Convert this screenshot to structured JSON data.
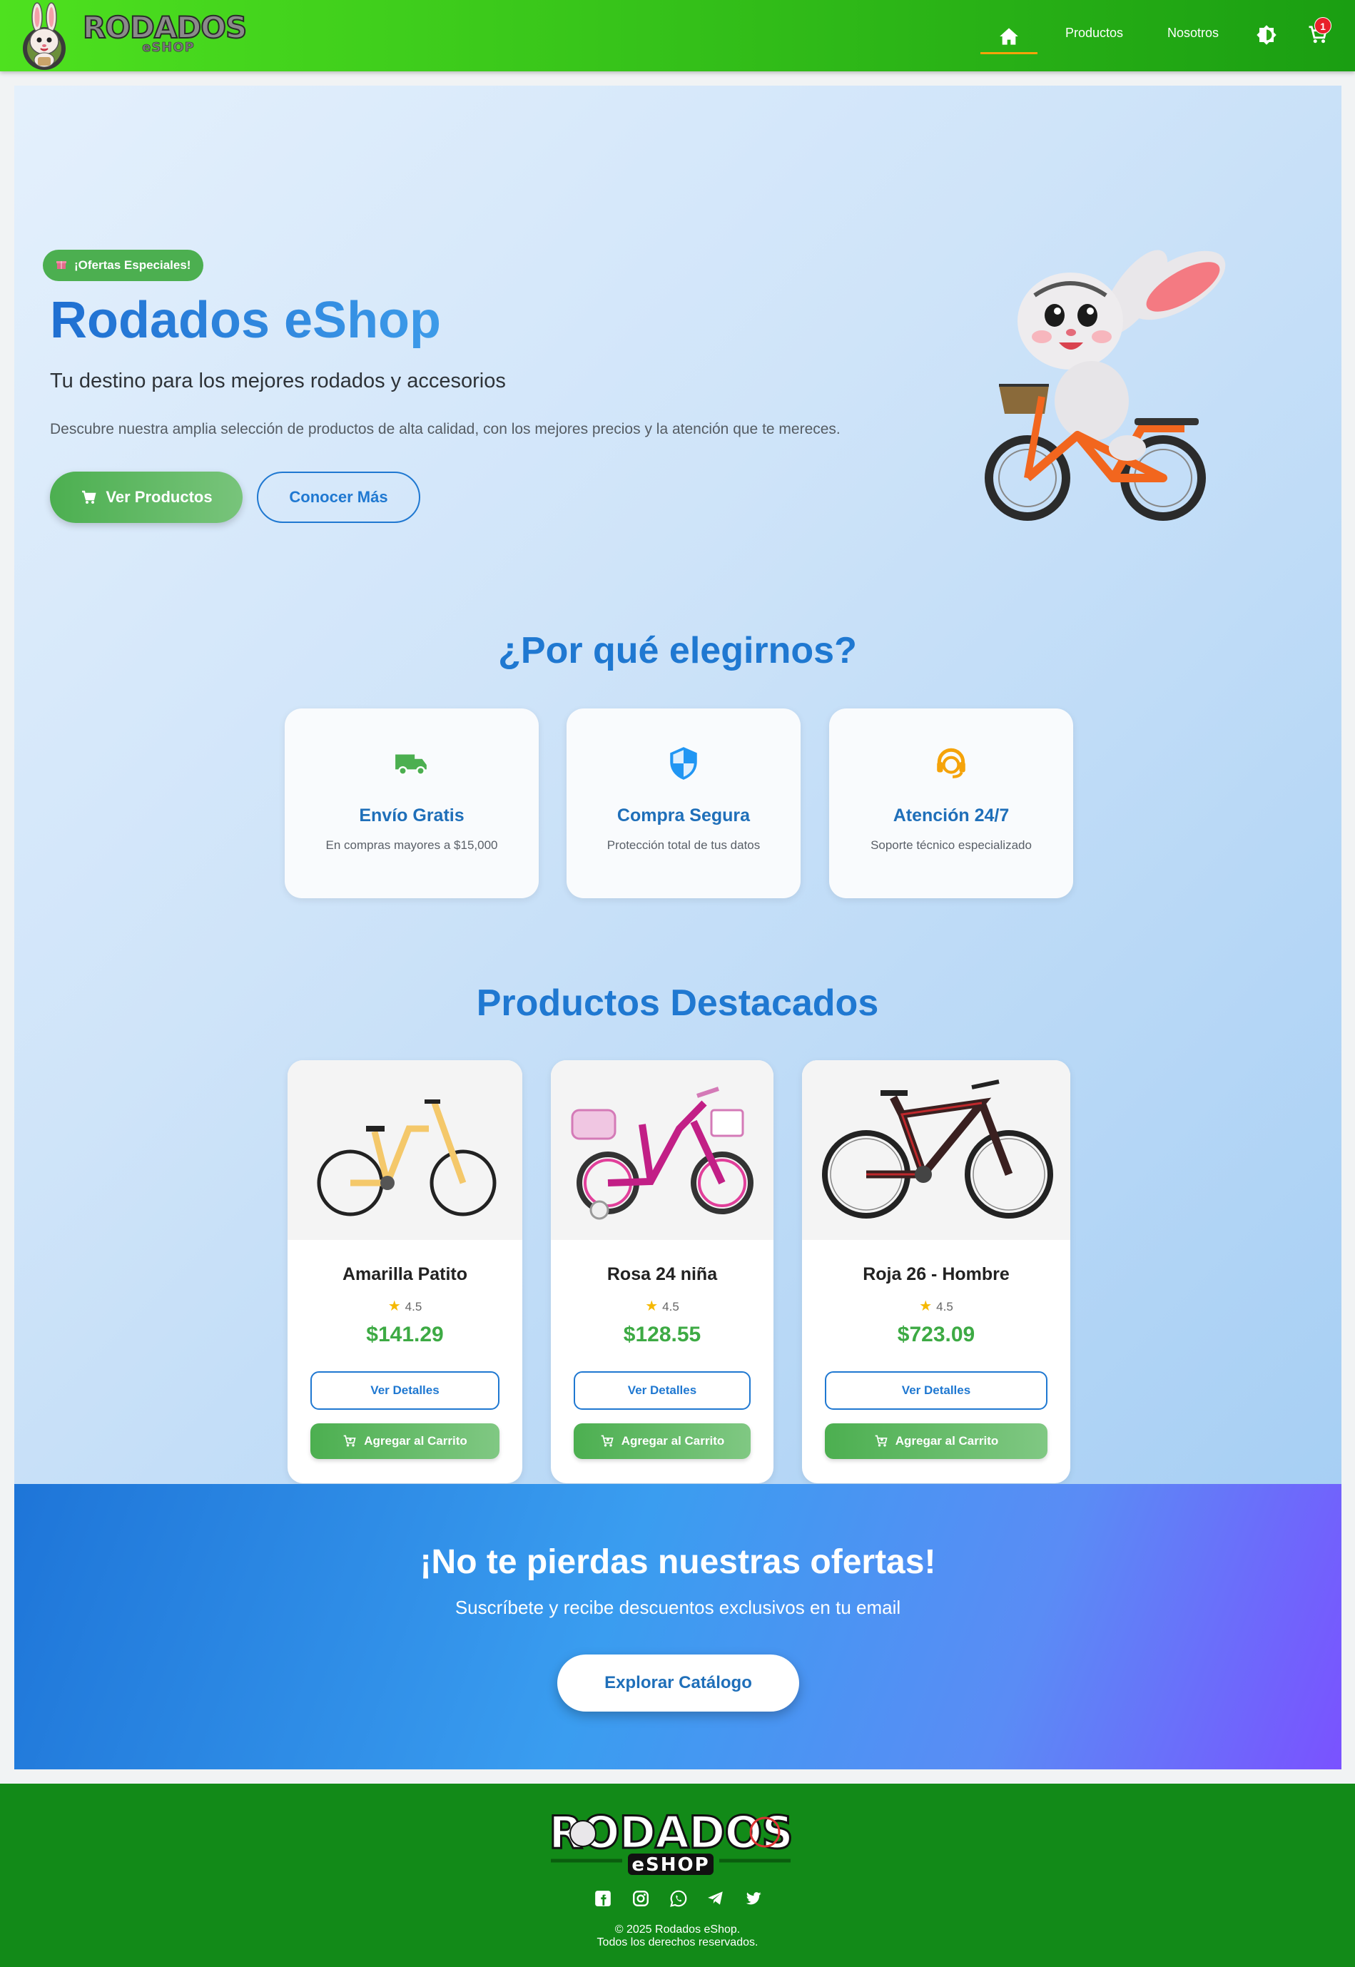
{
  "brand": {
    "logo_main": "RODADOS",
    "logo_sub": "eSHOP"
  },
  "nav": {
    "products": "Productos",
    "about": "Nosotros",
    "cart_count": "1"
  },
  "hero": {
    "badge": "¡Ofertas Especiales!",
    "title": "Rodados eShop",
    "subtitle": "Tu destino para los mejores rodados y accesorios",
    "description": "Descubre nuestra amplia selección de productos de alta calidad, con los mejores precios y la atención que te mereces.",
    "btn_products": "Ver Productos",
    "btn_more": "Conocer Más"
  },
  "why": {
    "title": "¿Por qué elegirnos?",
    "features": [
      {
        "name": "Envío Gratis",
        "desc": "En compras mayores a $15,000",
        "icon": "truck-icon",
        "color": "#4caf50"
      },
      {
        "name": "Compra Segura",
        "desc": "Protección total de tus datos",
        "icon": "shield-icon",
        "color": "#2196f3"
      },
      {
        "name": "Atención 24/7",
        "desc": "Soporte técnico especializado",
        "icon": "support-agent-icon",
        "color": "#f5a30a"
      }
    ]
  },
  "featured": {
    "title": "Productos Destacados",
    "details_label": "Ver Detalles",
    "cart_label": "Agregar al Carrito",
    "products": [
      {
        "name": "Amarilla Patito",
        "rating": "4.5",
        "price": "$141.29"
      },
      {
        "name": "Rosa 24 niña",
        "rating": "4.5",
        "price": "$128.55"
      },
      {
        "name": "Roja 26 - Hombre",
        "rating": "4.5",
        "price": "$723.09"
      }
    ]
  },
  "cta": {
    "title": "¡No te pierdas nuestras ofertas!",
    "subtitle": "Suscríbete y recibe descuentos exclusivos en tu email",
    "button": "Explorar Catálogo"
  },
  "footer": {
    "logo_main": "RODADOS",
    "logo_sub": "eSHOP",
    "copyright_line1": "© 2025 Rodados eShop.",
    "copyright_line2": "Todos los derechos reservados.",
    "socials": [
      "facebook-icon",
      "instagram-icon",
      "whatsapp-icon",
      "telegram-icon",
      "twitter-icon"
    ]
  },
  "colors": {
    "nav_green": "#37c41a",
    "accent_blue": "#1f78d1",
    "price_green": "#3daa44",
    "footer_green": "#128a18",
    "badge_red": "#e8202a"
  }
}
